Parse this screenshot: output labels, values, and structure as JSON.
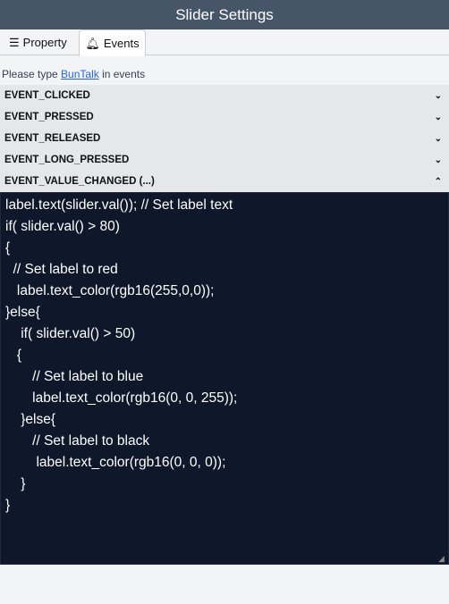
{
  "window": {
    "title": "Slider Settings"
  },
  "tabs": [
    {
      "label": "Property",
      "icon": "list-icon"
    },
    {
      "label": "Events",
      "icon": "bell-icon",
      "active": true
    }
  ],
  "hint": {
    "prefix": "Please type ",
    "link": "BunTalk",
    "suffix": " in events"
  },
  "events": [
    {
      "label": "EVENT_CLICKED",
      "expanded": false
    },
    {
      "label": "EVENT_PRESSED",
      "expanded": false
    },
    {
      "label": "EVENT_RELEASED",
      "expanded": false
    },
    {
      "label": "EVENT_LONG_PRESSED",
      "expanded": false
    },
    {
      "label": "EVENT_VALUE_CHANGED (...)",
      "expanded": true
    }
  ],
  "code": "label.text(slider.val()); // Set label text\nif( slider.val() > 80)\n{\n  // Set label to red\n   label.text_color(rgb16(255,0,0));\n}else{\n    if( slider.val() > 50)\n   {\n       // Set label to blue\n       label.text_color(rgb16(0, 0, 255));\n    }else{\n       // Set label to black\n        label.text_color(rgb16(0, 0, 0));\n    }\n}"
}
